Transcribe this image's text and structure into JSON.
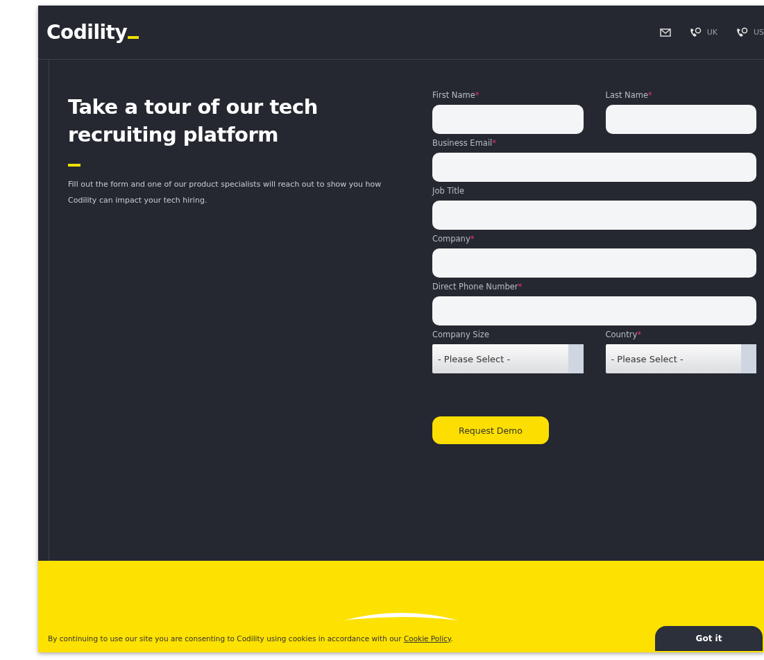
{
  "header": {
    "logo": "Codility",
    "contacts": [
      {
        "kind": "mail"
      },
      {
        "kind": "phone",
        "label": "UK"
      },
      {
        "kind": "phone",
        "label": "US"
      }
    ]
  },
  "intro": {
    "title": "Take a tour of our tech recruiting platform",
    "text": "Fill out the form and one of our product specialists will reach out to show you how Codility can impact your tech hiring."
  },
  "form": {
    "rows": [
      [
        {
          "label": "First Name",
          "required_mark": "*",
          "kind": "text"
        },
        {
          "label": "Last Name",
          "required_mark": "*",
          "kind": "text"
        }
      ],
      [
        {
          "label": "Business Email",
          "required_mark": "*",
          "kind": "text"
        }
      ],
      [
        {
          "label": "Job Title",
          "kind": "text"
        }
      ],
      [
        {
          "label": "Company",
          "required_mark": "*",
          "kind": "text"
        }
      ],
      [
        {
          "label": "Direct Phone Number",
          "required_mark": "*",
          "kind": "text"
        }
      ],
      [
        {
          "label": "Company Size",
          "kind": "select",
          "value": "- Please Select -"
        },
        {
          "label": "Country",
          "required_mark": "*",
          "kind": "select",
          "value": "- Please Select -"
        }
      ]
    ],
    "submit": "Request Demo"
  },
  "cookie_banner": {
    "text": "By continuing to use our site you are consenting to Codility using cookies in accordance with our",
    "link": "Cookie Policy",
    "after": ".",
    "button": "Got it"
  }
}
